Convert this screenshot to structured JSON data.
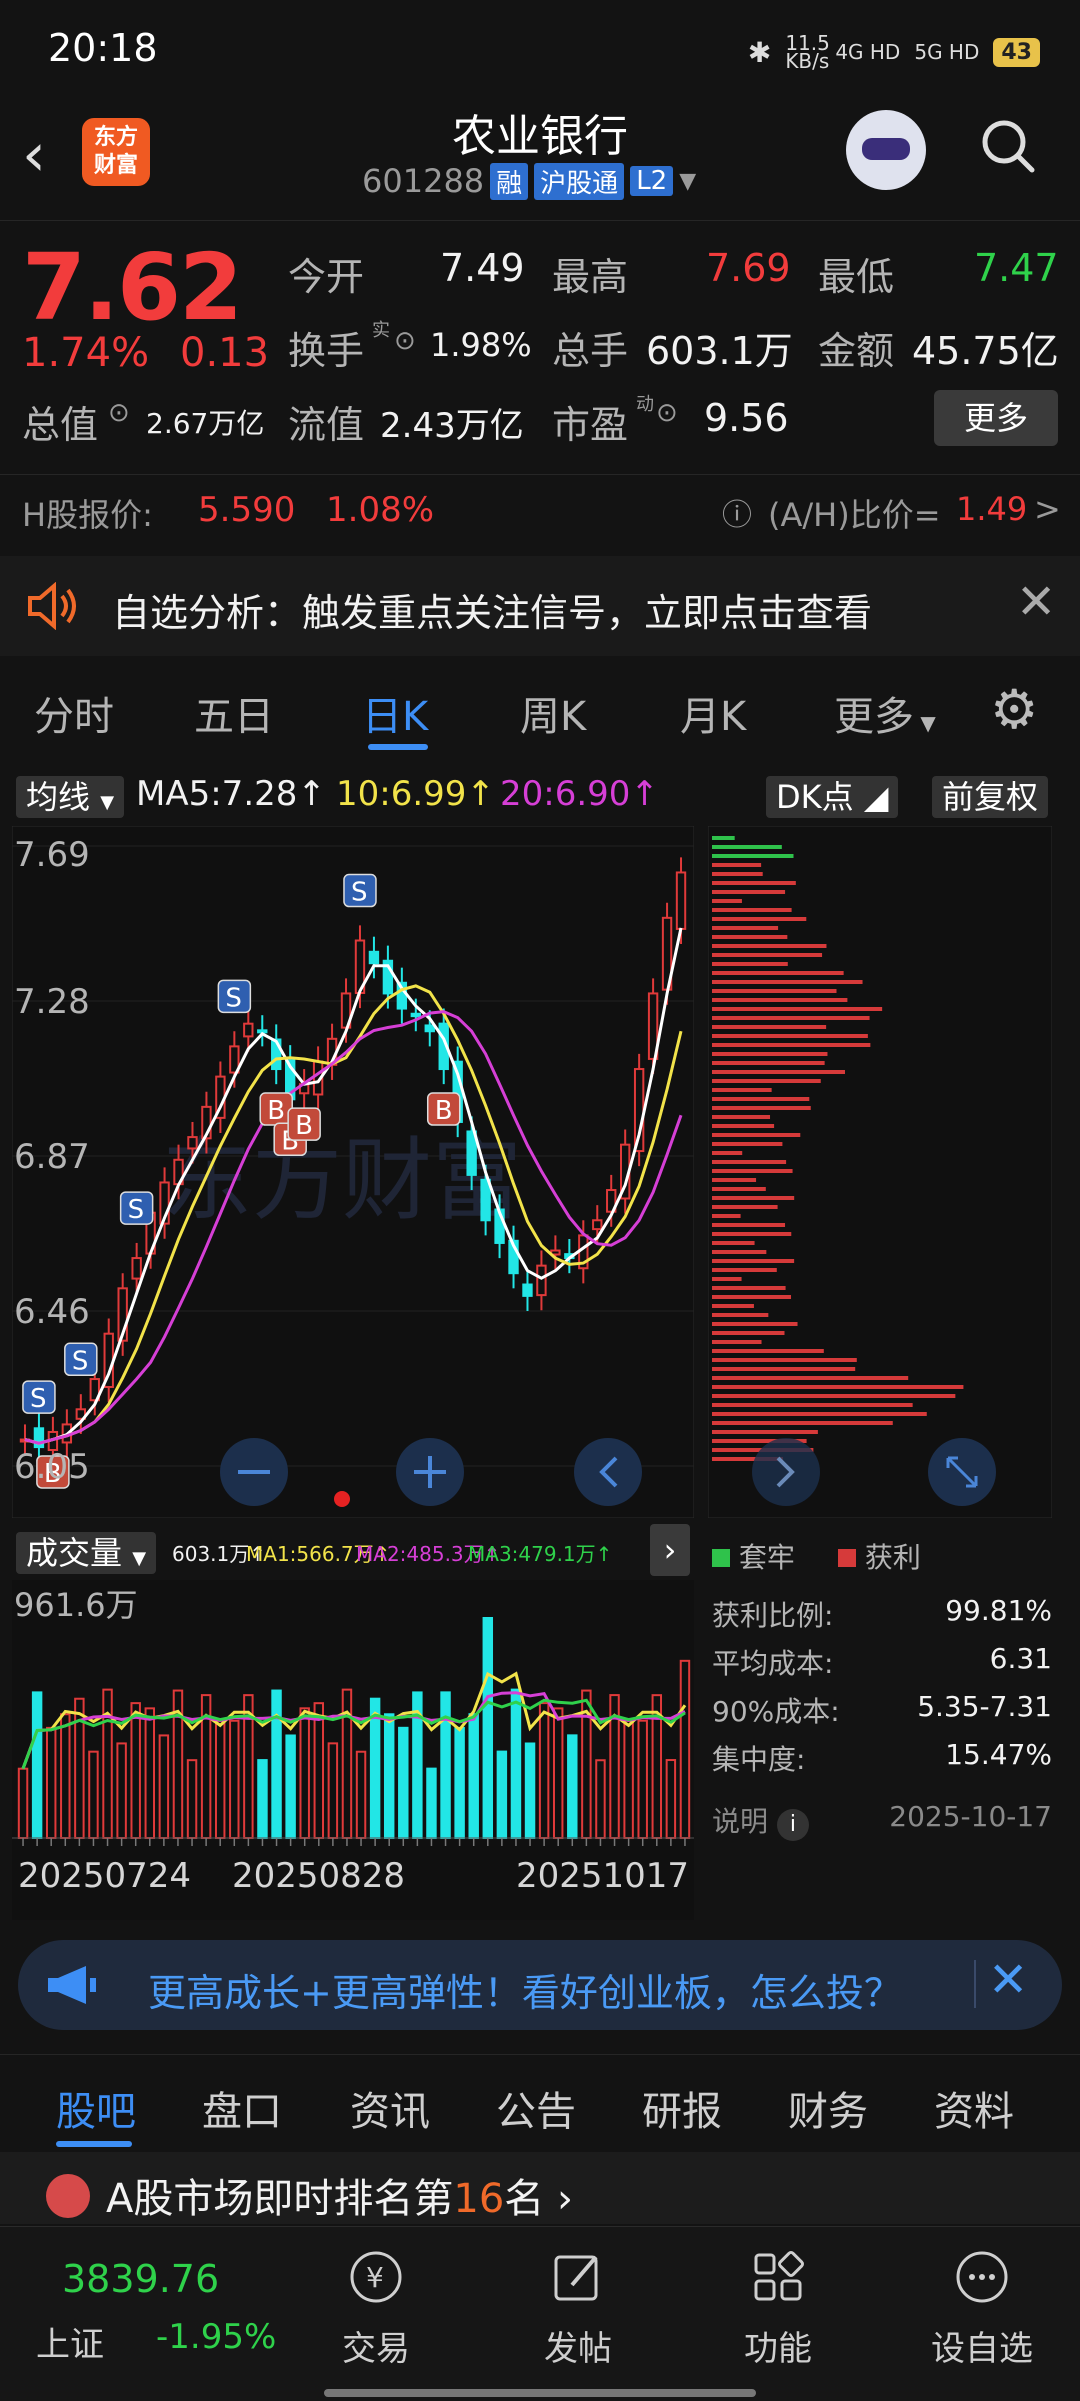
{
  "status": {
    "time": "20:18",
    "net_speed": "11.5 KB/s",
    "net1": "4G HD",
    "net2": "5G HD",
    "battery": "43"
  },
  "header": {
    "stock_name": "农业银行",
    "stock_code": "601288",
    "tag_rong": "融",
    "tag_hgt": "沪股通",
    "tag_l2": "L2",
    "logo_line1": "东方",
    "logo_line2": "财富"
  },
  "quote": {
    "price": "7.62",
    "change_pct": "1.74%",
    "change": "0.13",
    "open_label": "今开",
    "open": "7.49",
    "high_label": "最高",
    "high": "7.69",
    "low_label": "最低",
    "low": "7.47",
    "turnover_label": "换手",
    "turnover_sup": "实",
    "turnover": "1.98%",
    "volume_label": "总手",
    "volume": "603.1万",
    "amount_label": "金额",
    "amount": "45.75亿",
    "mcap_label": "总值",
    "mcap": "2.67万亿",
    "float_label": "流值",
    "float_cap": "2.43万亿",
    "pe_label": "市盈",
    "pe_sup": "动",
    "pe": "9.56",
    "more": "更多",
    "h_label": "H股报价:",
    "h_price": "5.590",
    "h_pct": "1.08%",
    "ah_label": "(A/H)比价=",
    "ah_value": "1.49",
    "ah_arrow": ">"
  },
  "notice": {
    "text": "自选分析：触发重点关注信号，立即点击查看"
  },
  "ktabs": [
    "分时",
    "五日",
    "日K",
    "周K",
    "月K",
    "更多"
  ],
  "ma": {
    "pill": "均线",
    "ma5": "MA5:7.28",
    "ma10": "10:6.99",
    "ma20": "20:6.90",
    "dk": "DK点",
    "fq": "前复权"
  },
  "chart_data": {
    "type": "candlestick",
    "ylim": [
      6.05,
      7.69
    ],
    "y_ticks": [
      "7.69",
      "7.28",
      "6.87",
      "6.46",
      "6.05"
    ],
    "signals": [
      "S",
      "B",
      "S",
      "S",
      "B",
      "B",
      "B",
      "S",
      "B",
      "S"
    ],
    "watermark": "东方财富",
    "volume": {
      "header": {
        "vol": "603.1万",
        "ma1": "MA1:566.7万",
        "ma2": "MA2:485.3万",
        "ma3": "MA3:479.1万"
      },
      "max_label": "961.6万",
      "dates": [
        "20250724",
        "20250828",
        "20251017"
      ]
    },
    "chips": {
      "legend_trapped": "套牢",
      "legend_profit": "获利",
      "profit_ratio_label": "获利比例:",
      "profit_ratio": "99.81%",
      "avg_cost_label": "平均成本:",
      "avg_cost": "6.31",
      "cost90_label": "90%成本:",
      "cost90": "5.35-7.31",
      "concentration_label": "集中度:",
      "concentration": "15.47%",
      "note_label": "说明",
      "date": "2025-10-17"
    }
  },
  "banner": {
    "text": "更高成长+更高弹性！看好创业板，怎么投？"
  },
  "subtabs": [
    "股吧",
    "盘口",
    "资讯",
    "公告",
    "研报",
    "财务",
    "资料"
  ],
  "rank": {
    "prefix": "A股市场即时排名第",
    "num": "16",
    "suffix": "名"
  },
  "nav": {
    "index_value": "3839.76",
    "index_name": "上证",
    "index_pct": "-1.95%",
    "items": [
      "交易",
      "发帖",
      "功能",
      "设自选"
    ]
  }
}
